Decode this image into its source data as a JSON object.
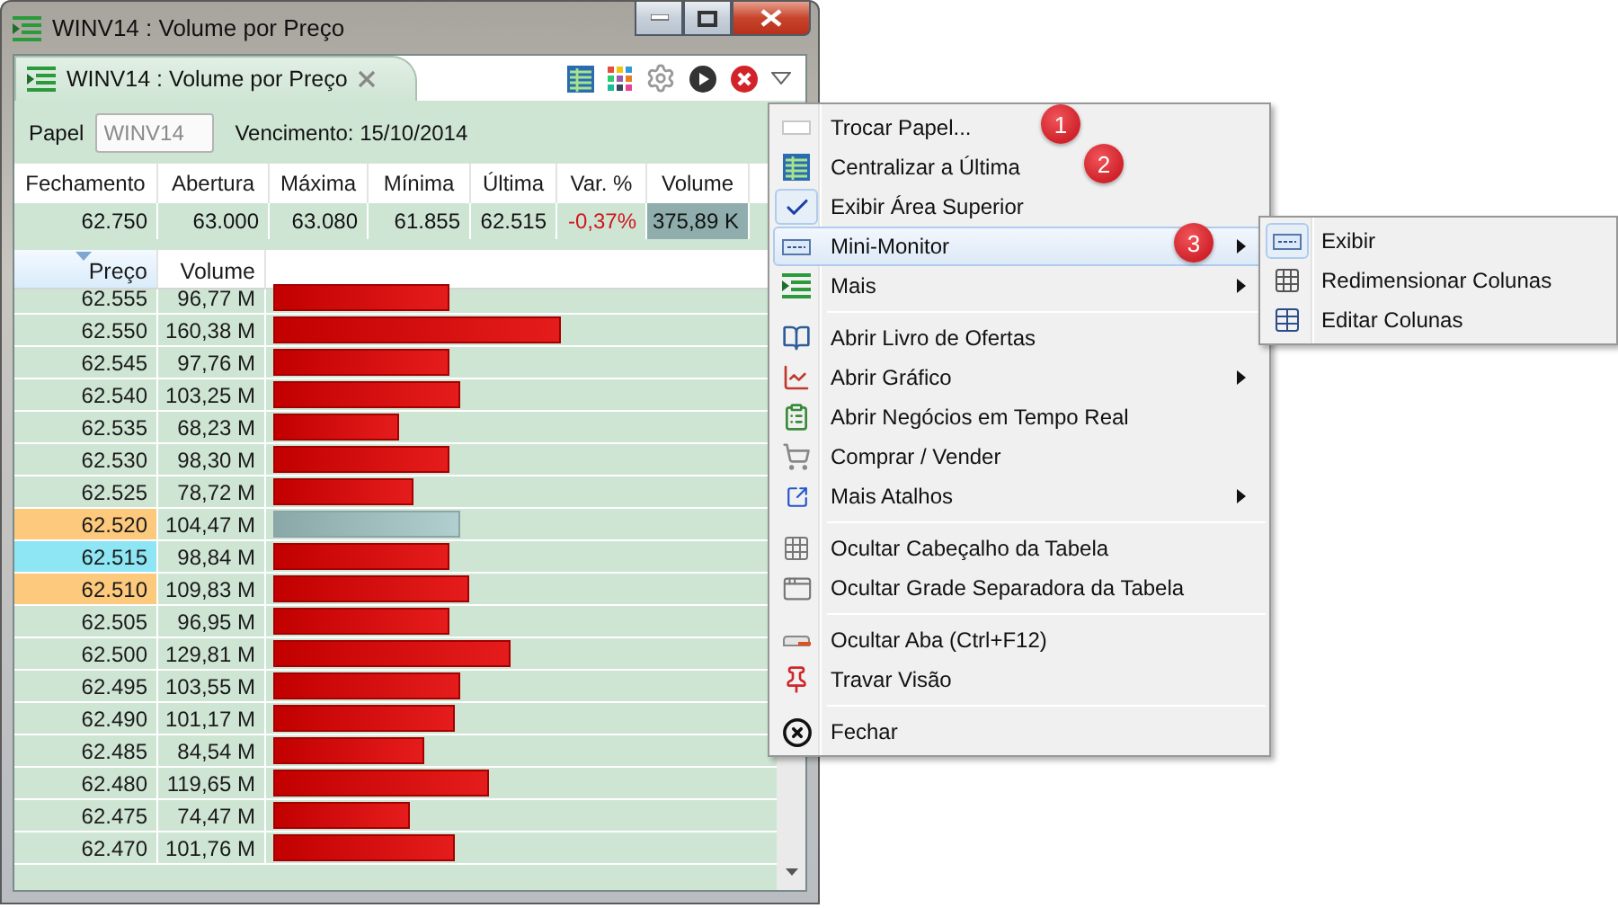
{
  "window": {
    "title": "WINV14 : Volume por Preço"
  },
  "tab": {
    "label": "WINV14 : Volume por Preço",
    "selected": true
  },
  "papel": {
    "label": "Papel",
    "value": "WINV14",
    "disabled": true,
    "vencimento": "Vencimento: 15/10/2014"
  },
  "summary": {
    "columns": [
      "Fechamento",
      "Abertura",
      "Máxima",
      "Mínima",
      "Última",
      "Var. %",
      "Volume"
    ],
    "values": [
      {
        "text": "62.750",
        "kind": "plain"
      },
      {
        "text": "63.000",
        "kind": "plain"
      },
      {
        "text": "63.080",
        "kind": "plain"
      },
      {
        "text": "61.855",
        "kind": "plain"
      },
      {
        "text": "62.515",
        "kind": "plain"
      },
      {
        "text": "-0,37%",
        "kind": "negative"
      },
      {
        "text": "375,89 K",
        "kind": "highlight"
      }
    ]
  },
  "table": {
    "columns": [
      {
        "label": "Preço",
        "sorted": true
      },
      {
        "label": "Volume",
        "sorted": false
      }
    ],
    "rows": [
      {
        "price": "62.555",
        "volume": "96,77 M",
        "level": 0.35,
        "kind": "down"
      },
      {
        "price": "62.550",
        "volume": "160,38 M",
        "level": 0.57,
        "kind": "down"
      },
      {
        "price": "62.545",
        "volume": "97,76 M",
        "level": 0.35,
        "kind": "down"
      },
      {
        "price": "62.540",
        "volume": "103,25 M",
        "level": 0.37,
        "kind": "down"
      },
      {
        "price": "62.535",
        "volume": "68,23 M",
        "level": 0.25,
        "kind": "down"
      },
      {
        "price": "62.530",
        "volume": "98,30 M",
        "level": 0.35,
        "kind": "down"
      },
      {
        "price": "62.525",
        "volume": "78,72 M",
        "level": 0.28,
        "kind": "down"
      },
      {
        "price": "62.520",
        "volume": "104,47 M",
        "level": 0.37,
        "kind": "neutral",
        "color": "#fdc97c"
      },
      {
        "price": "62.515",
        "volume": "98,84 M",
        "level": 0.35,
        "kind": "down",
        "color": "#8ee6f5"
      },
      {
        "price": "62.510",
        "volume": "109,83 M",
        "level": 0.39,
        "kind": "down",
        "color": "#fdc97c"
      },
      {
        "price": "62.505",
        "volume": "96,95 M",
        "level": 0.35,
        "kind": "down"
      },
      {
        "price": "62.500",
        "volume": "129,81 M",
        "level": 0.47,
        "kind": "down"
      },
      {
        "price": "62.495",
        "volume": "103,55 M",
        "level": 0.37,
        "kind": "down"
      },
      {
        "price": "62.490",
        "volume": "101,17 M",
        "level": 0.36,
        "kind": "down"
      },
      {
        "price": "62.485",
        "volume": "84,54 M",
        "level": 0.3,
        "kind": "down"
      },
      {
        "price": "62.480",
        "volume": "119,65 M",
        "level": 0.43,
        "kind": "down"
      },
      {
        "price": "62.475",
        "volume": "74,47 M",
        "level": 0.27,
        "kind": "down"
      },
      {
        "price": "62.470",
        "volume": "101,76 M",
        "level": 0.36,
        "kind": "down"
      }
    ]
  },
  "menu": {
    "groups": [
      [
        {
          "label": "Trocar Papel...",
          "checked": false,
          "selected": false,
          "submenu": false,
          "badge": "1"
        },
        {
          "label": "Centralizar a Última",
          "checked": false,
          "selected": false,
          "submenu": false,
          "badge": "2"
        },
        {
          "label": "Exibir Área Superior",
          "checked": true,
          "selected": false,
          "submenu": false
        },
        {
          "label": "Mini-Monitor",
          "checked": false,
          "selected": true,
          "submenu": true,
          "badge": "3"
        },
        {
          "label": "Mais",
          "checked": false,
          "selected": false,
          "submenu": true
        }
      ],
      [
        {
          "label": "Abrir Livro de Ofertas",
          "checked": false,
          "selected": false,
          "submenu": false
        },
        {
          "label": "Abrir Gráfico",
          "checked": false,
          "selected": false,
          "submenu": true
        },
        {
          "label": "Abrir Negócios em Tempo Real",
          "checked": false,
          "selected": false,
          "submenu": false
        },
        {
          "label": "Comprar / Vender",
          "checked": false,
          "selected": false,
          "submenu": false
        },
        {
          "label": "Mais Atalhos",
          "checked": false,
          "selected": false,
          "submenu": true
        }
      ],
      [
        {
          "label": "Ocultar Cabeçalho da Tabela",
          "checked": false,
          "selected": false,
          "submenu": false
        },
        {
          "label": "Ocultar Grade Separadora da Tabela",
          "checked": false,
          "selected": false,
          "submenu": false
        }
      ],
      [
        {
          "label": "Ocultar Aba (Ctrl+F12)",
          "checked": false,
          "selected": false,
          "submenu": false
        },
        {
          "label": "Travar Visão",
          "checked": false,
          "selected": false,
          "submenu": false
        }
      ],
      [
        {
          "label": "Fechar",
          "checked": false,
          "selected": false,
          "submenu": false
        }
      ]
    ]
  },
  "submenu": {
    "items": [
      {
        "label": "Exibir",
        "checked": true
      },
      {
        "label": "Redimensionar Colunas",
        "checked": false
      },
      {
        "label": "Editar Colunas",
        "checked": false
      }
    ]
  }
}
